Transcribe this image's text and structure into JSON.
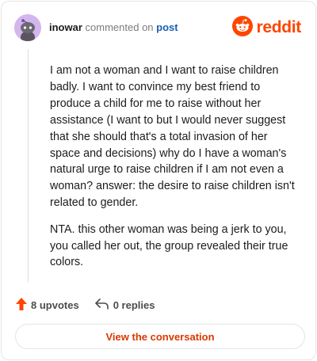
{
  "header": {
    "username": "inowar",
    "verb": "commented on",
    "post_link": "post",
    "brand": "reddit"
  },
  "comment": {
    "paragraphs": [
      "I am not a woman and I want to raise children badly. I want to convince my best friend to produce a child for me to raise without her assistance (I want to but I would never suggest that she should that's a total invasion of her space and decisions) why do I have a woman's natural urge to raise children if I am not even a woman? answer: the desire to raise children isn't related to gender.",
      "NTA. this other woman was being a jerk to you, you called her out, the group revealed their true colors."
    ]
  },
  "footer": {
    "upvotes": "8 upvotes",
    "replies": "0 replies",
    "view_button": "View the conversation"
  },
  "colors": {
    "brand": "#ff4500",
    "link": "#1a5fb4",
    "button_text": "#d93900",
    "avatar_bg": "#d4b6ee"
  },
  "icons": {
    "avatar": "snoo-avatar-icon",
    "logo": "reddit-snoo-icon",
    "upvote": "upvote-arrow-icon",
    "reply": "reply-arrow-icon"
  }
}
